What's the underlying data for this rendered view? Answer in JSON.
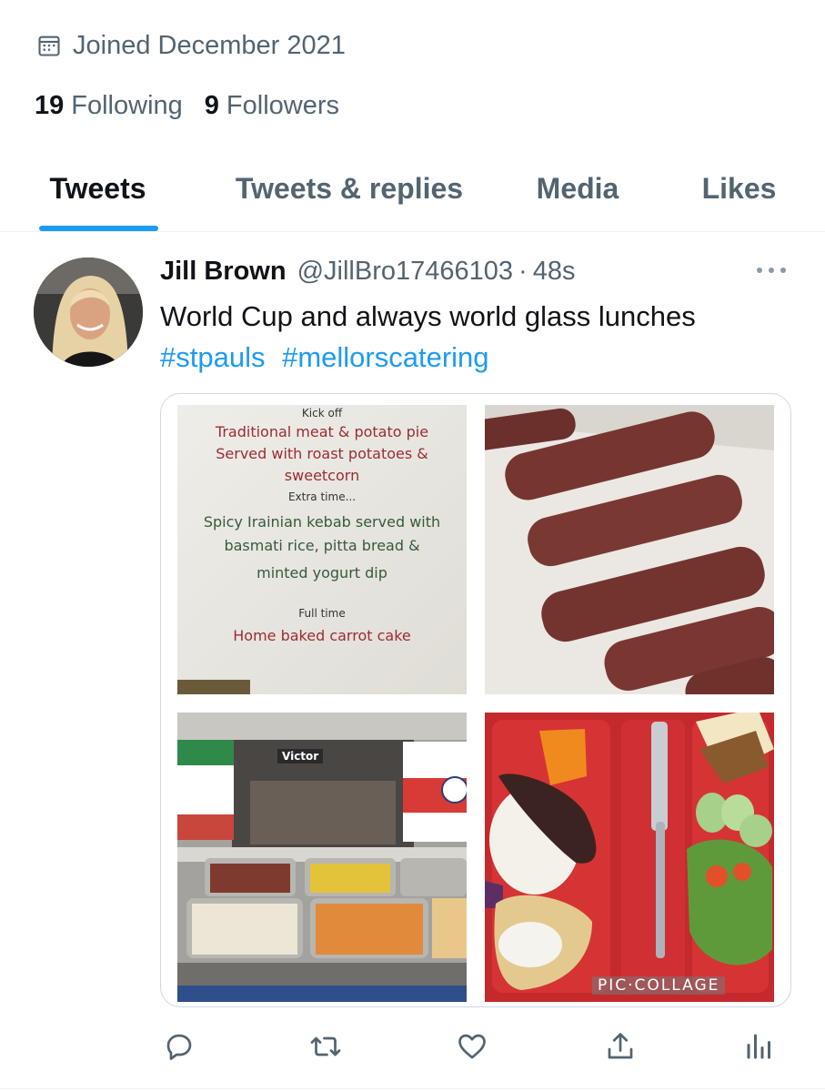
{
  "profile": {
    "joined_text": "Joined December 2021",
    "following_count": "19",
    "following_label": "Following",
    "followers_count": "9",
    "followers_label": "Followers"
  },
  "tabs": [
    {
      "label": "Tweets",
      "active": true
    },
    {
      "label": "Tweets & replies",
      "active": false
    },
    {
      "label": "Media",
      "active": false
    },
    {
      "label": "Likes",
      "active": false
    }
  ],
  "tweet": {
    "author_name": "Jill Brown",
    "author_handle": "@JillBro17466103",
    "separator": "·",
    "time": "48s",
    "text": "World Cup and always world glass lunches",
    "hashtags": [
      "#stpauls",
      "#mellorscatering"
    ],
    "media": {
      "menu_card": {
        "line1": "Kick off",
        "line2": "Traditional meat & potato pie",
        "line3": "Served with roast potatoes &",
        "line4": "sweetcorn",
        "line5": "Extra time...",
        "line6": "Spicy Irainian kebab served with",
        "line7": "basmati rice, pitta bread &",
        "line8": "minted yogurt dip",
        "line9": "Full time",
        "line10": "Home baked carrot cake"
      },
      "counter_sign": "Victor",
      "watermark": "PIC·COLLAGE"
    }
  },
  "colors": {
    "accent": "#1d9bf0",
    "secondary_text": "#536471",
    "primary_text": "#0f1419"
  },
  "icons": [
    "calendar-icon",
    "more-icon",
    "reply-icon",
    "retweet-icon",
    "like-icon",
    "share-icon",
    "analytics-icon"
  ]
}
